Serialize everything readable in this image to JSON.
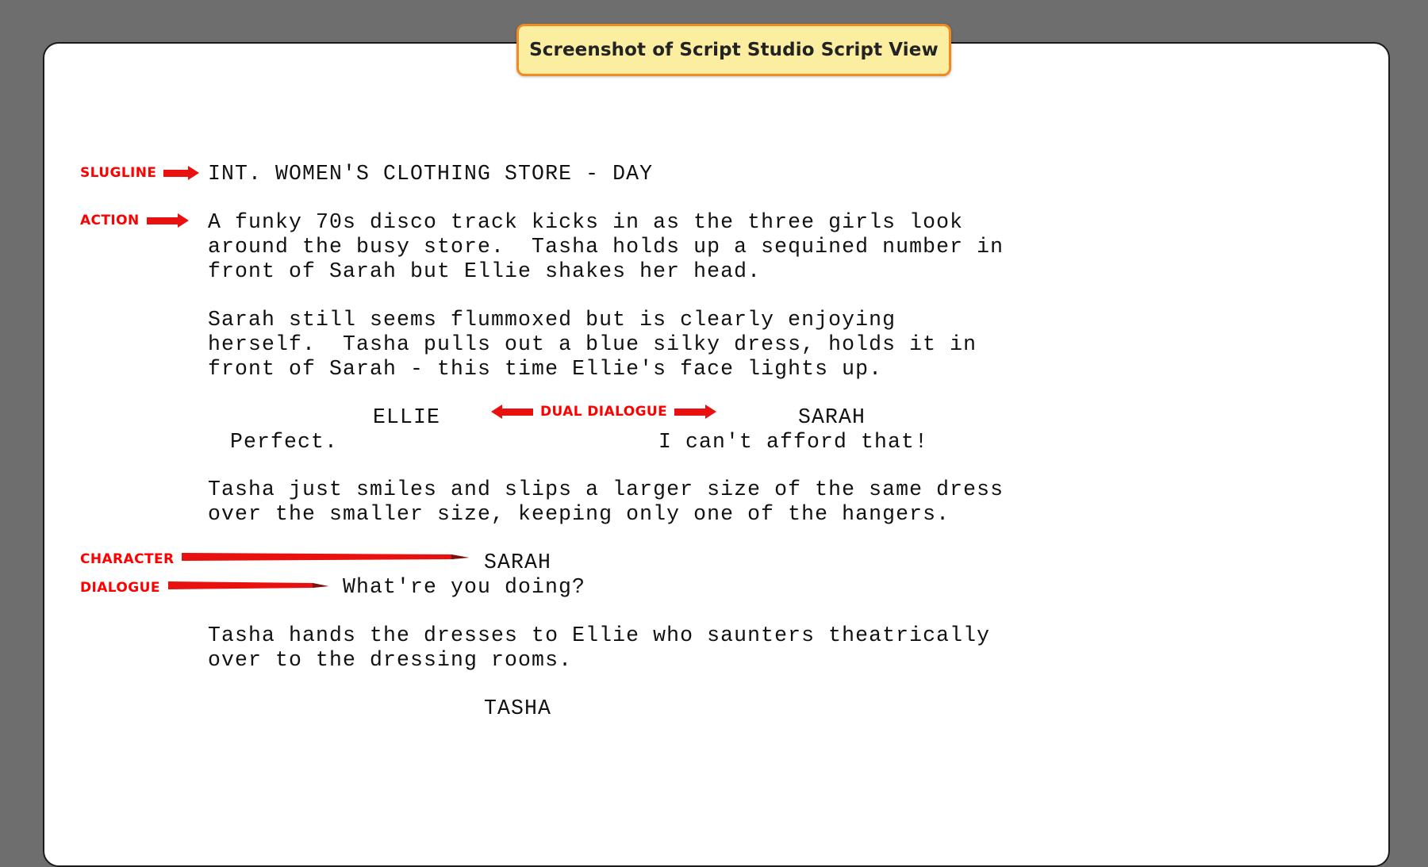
{
  "badge": {
    "text": "Screenshot of Script Studio Script View"
  },
  "annotations": {
    "slugline": "SLUGLINE",
    "action": "ACTION",
    "dual_dialogue": "DUAL DIALOGUE",
    "character": "CHARACTER",
    "dialogue": "DIALOGUE"
  },
  "colors": {
    "annotation_red": "#ff0000",
    "arrow_red": "#e8110f",
    "badge_fill": "#fbeea0",
    "badge_border": "#ef8b22",
    "page_background": "#6e6e6e",
    "document_background": "#ffffff"
  },
  "script": {
    "slugline": "INT. WOMEN'S CLOTHING STORE - DAY",
    "action_1": [
      "A funky 70s disco track kicks in as the three girls look",
      "around the busy store.  Tasha holds up a sequined number in",
      "front of Sarah but Ellie shakes her head."
    ],
    "action_2": [
      "Sarah still seems flummoxed but is clearly enjoying",
      "herself.  Tasha pulls out a blue silky dress, holds it in",
      "front of Sarah - this time Ellie's face lights up."
    ],
    "dual": {
      "left_character": "ELLIE",
      "left_dialogue": "Perfect.",
      "right_character": "SARAH",
      "right_dialogue": "I can't afford that!"
    },
    "action_3": [
      "Tasha just smiles and slips a larger size of the same dress",
      "over the smaller size, keeping only one of the hangers."
    ],
    "character_2": "SARAH",
    "dialogue_2": "What're you doing?",
    "action_4": [
      "Tasha hands the dresses to Ellie who saunters theatrically",
      "over to the dressing rooms."
    ],
    "character_3": "TASHA"
  }
}
